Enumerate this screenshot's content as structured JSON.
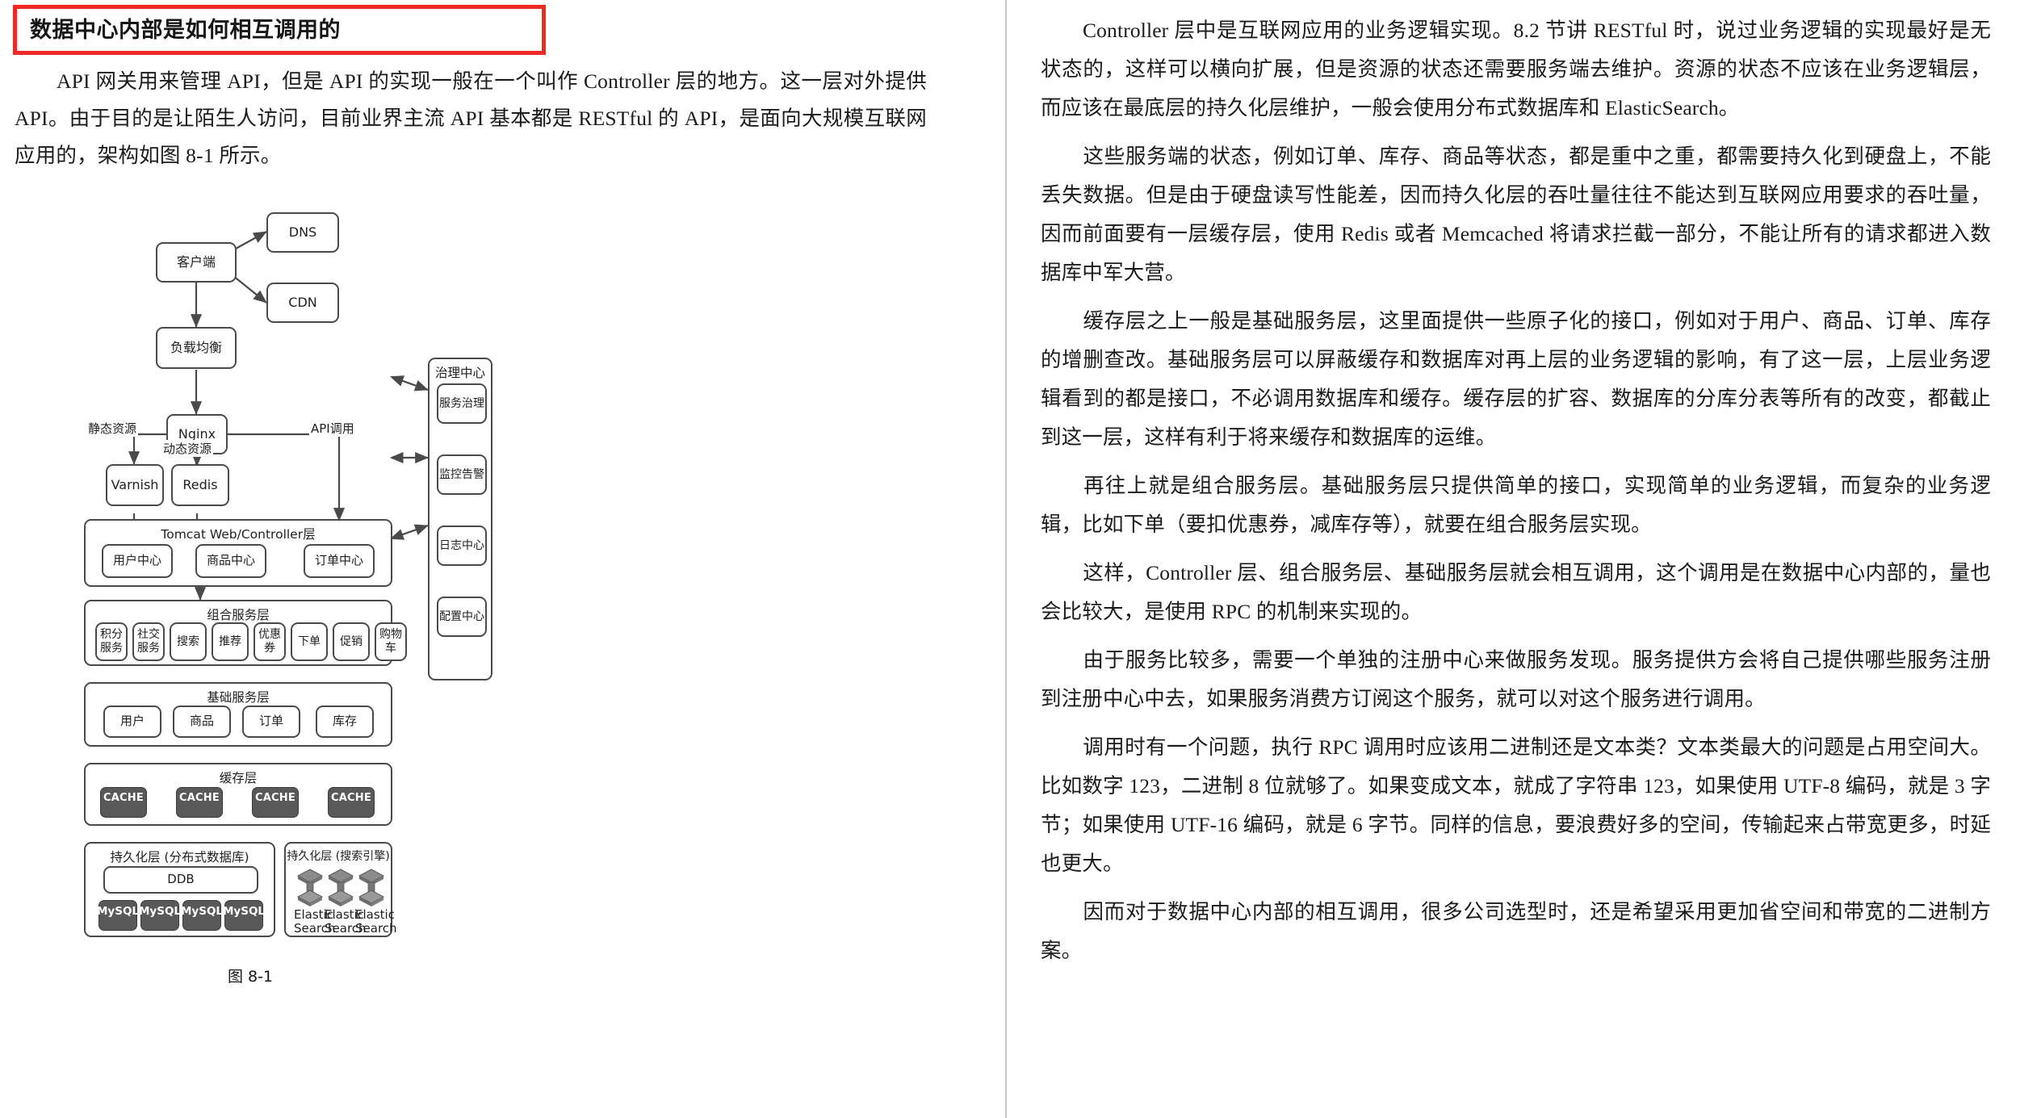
{
  "heading": {
    "title": "数据中心内部是如何相互调用的"
  },
  "intro": {
    "text": "API 网关用来管理 API，但是 API 的实现一般在一个叫作 Controller 层的地方。这一层对外提供 API。由于目的是让陌生人访问，目前业界主流 API 基本都是 RESTful 的 API，是面向大规模互联网应用的，架构如图 8-1 所示。"
  },
  "figure": {
    "caption": "图 8-1",
    "nodes": {
      "client": "客户端",
      "dns": "DNS",
      "cdn": "CDN",
      "lb": "负载均衡",
      "nginx": "Nginx",
      "varnish": "Varnish",
      "redis": "Redis",
      "ddb": "DDB"
    },
    "edge_labels": {
      "static": "静态资源",
      "dynamic": "动态资源",
      "api_call": "API调用"
    },
    "layers": {
      "controller": {
        "title": "Tomcat Web/Controller层",
        "items": [
          "用户中心",
          "商品中心",
          "订单中心"
        ]
      },
      "composite": {
        "title": "组合服务层",
        "items": [
          "积分\n服务",
          "社交\n服务",
          "搜索",
          "推荐",
          "优惠\n券",
          "下单",
          "促销",
          "购物\n车"
        ]
      },
      "basic": {
        "title": "基础服务层",
        "items": [
          "用户",
          "商品",
          "订单",
          "库存"
        ]
      },
      "cache": {
        "title": "缓存层",
        "items": [
          "CACHE",
          "CACHE",
          "CACHE",
          "CACHE"
        ]
      },
      "persist_db": {
        "title": "持久化层 (分布式数据库)",
        "ddb": "DDB",
        "items": [
          "MySQL",
          "MySQL",
          "MySQL",
          "MySQL"
        ]
      },
      "persist_search": {
        "title": "持久化层 (搜索引擎)",
        "items": [
          "Elastic\nSearch",
          "Elastic\nSearch",
          "Elastic\nSearch"
        ]
      },
      "governance": {
        "title": "治理中心",
        "items": [
          "服务治理",
          "监控告警",
          "日志中心",
          "配置中心"
        ]
      }
    }
  },
  "right_column": {
    "paragraphs": [
      "Controller 层中是互联网应用的业务逻辑实现。8.2 节讲 RESTful 时，说过业务逻辑的实现最好是无状态的，这样可以横向扩展，但是资源的状态还需要服务端去维护。资源的状态不应该在业务逻辑层，而应该在最底层的持久化层维护，一般会使用分布式数据库和 ElasticSearch。",
      "这些服务端的状态，例如订单、库存、商品等状态，都是重中之重，都需要持久化到硬盘上，不能丢失数据。但是由于硬盘读写性能差，因而持久化层的吞吐量往往不能达到互联网应用要求的吞吐量，因而前面要有一层缓存层，使用 Redis 或者 Memcached 将请求拦截一部分，不能让所有的请求都进入数据库中军大营。",
      "缓存层之上一般是基础服务层，这里面提供一些原子化的接口，例如对于用户、商品、订单、库存的增删查改。基础服务层可以屏蔽缓存和数据库对再上层的业务逻辑的影响，有了这一层，上层业务逻辑看到的都是接口，不必调用数据库和缓存。缓存层的扩容、数据库的分库分表等所有的改变，都截止到这一层，这样有利于将来缓存和数据库的运维。",
      "再往上就是组合服务层。基础服务层只提供简单的接口，实现简单的业务逻辑，而复杂的业务逻辑，比如下单（要扣优惠券，减库存等），就要在组合服务层实现。",
      "这样，Controller 层、组合服务层、基础服务层就会相互调用，这个调用是在数据中心内部的，量也会比较大，是使用 RPC 的机制来实现的。",
      "由于服务比较多，需要一个单独的注册中心来做服务发现。服务提供方会将自己提供哪些服务注册到注册中心中去，如果服务消费方订阅这个服务，就可以对这个服务进行调用。",
      "调用时有一个问题，执行 RPC 调用时应该用二进制还是文本类？文本类最大的问题是占用空间大。比如数字 123，二进制 8 位就够了。如果变成文本，就成了字符串 123，如果使用 UTF-8 编码，就是 3 字节；如果使用 UTF-16 编码，就是 6 字节。同样的信息，要浪费好多的空间，传输起来占带宽更多，时延也更大。",
      "因而对于数据中心内部的相互调用，很多公司选型时，还是希望采用更加省空间和带宽的二进制方案。"
    ]
  },
  "colors": {
    "highlight_border": "#ee2a24",
    "node_stroke": "#4a4a4a",
    "chip_fill": "#595959",
    "divider": "#c9c9c9"
  }
}
